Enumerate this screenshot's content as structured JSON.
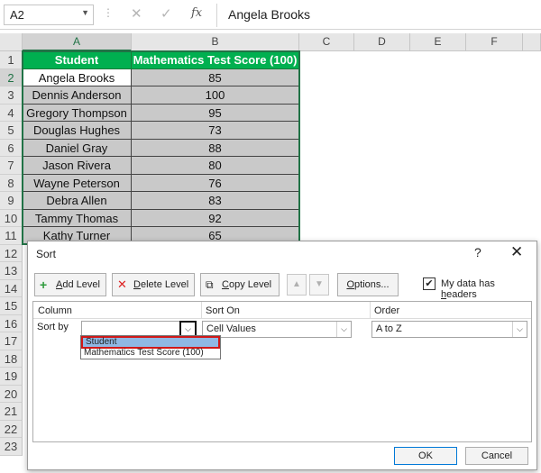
{
  "formula_bar": {
    "name_box": "A2",
    "fx": "fx",
    "value": "Angela Brooks"
  },
  "columns": [
    "A",
    "B",
    "C",
    "D",
    "E",
    "F"
  ],
  "rows": [
    "1",
    "2",
    "3",
    "4",
    "5",
    "6",
    "7",
    "8",
    "9",
    "10",
    "11",
    "12",
    "13",
    "14",
    "15",
    "16",
    "17",
    "18",
    "19",
    "20",
    "21",
    "22",
    "23"
  ],
  "table": {
    "headers": [
      "Student",
      "Mathematics Test Score (100)"
    ],
    "rows": [
      [
        "Angela Brooks",
        "85"
      ],
      [
        "Dennis Anderson",
        "100"
      ],
      [
        "Gregory Thompson",
        "95"
      ],
      [
        "Douglas Hughes",
        "73"
      ],
      [
        "Daniel Gray",
        "88"
      ],
      [
        "Jason Rivera",
        "80"
      ],
      [
        "Wayne Peterson",
        "76"
      ],
      [
        "Debra Allen",
        "83"
      ],
      [
        "Tammy Thomas",
        "92"
      ],
      [
        "Kathy Turner",
        "65"
      ]
    ]
  },
  "dialog": {
    "title": "Sort",
    "help": "?",
    "close": "✕",
    "add_level": {
      "pre": "",
      "ul": "A",
      "post": "dd Level"
    },
    "delete_level": {
      "pre": "",
      "ul": "D",
      "post": "elete Level"
    },
    "copy_level": {
      "pre": "",
      "ul": "C",
      "post": "opy Level"
    },
    "options": {
      "pre": "",
      "ul": "O",
      "post": "ptions..."
    },
    "headers_checkbox": {
      "checked": true,
      "label_pre": "My data has ",
      "ul": "h",
      "label_post": "eaders"
    },
    "col_column": "Column",
    "col_sort_on": "Sort On",
    "col_order": "Order",
    "sort_by_label": "Sort by",
    "sort_by_value": "",
    "sort_on_value": "Cell Values",
    "order_value": "A to Z",
    "dropdown_items": [
      "Student",
      "Mathematics Test Score (100)"
    ],
    "ok": "OK",
    "cancel": "Cancel"
  }
}
